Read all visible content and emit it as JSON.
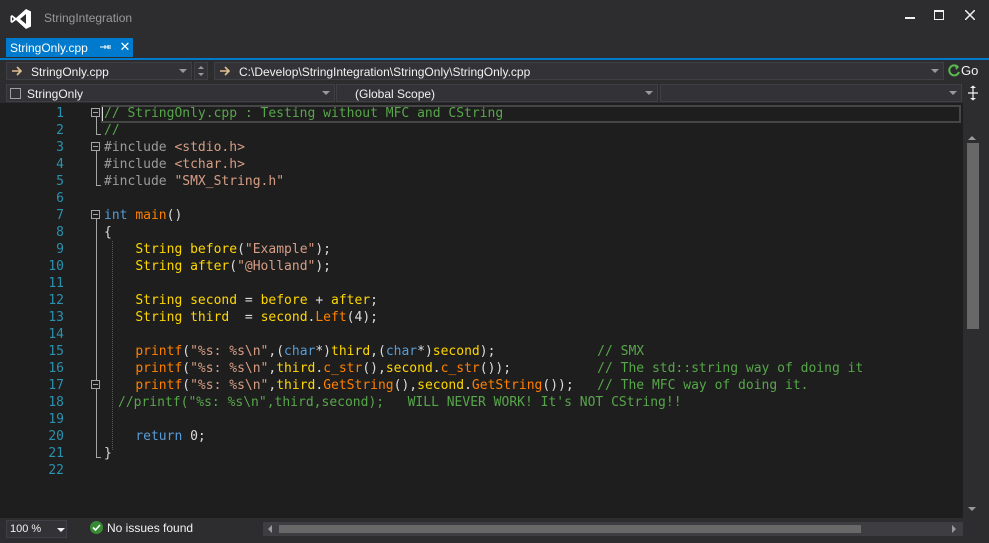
{
  "window": {
    "title": "StringIntegration"
  },
  "tabs": [
    {
      "label": "StringOnly.cpp",
      "active": true
    }
  ],
  "nav": {
    "file_combo": "StringOnly.cpp",
    "path_combo": "C:\\Develop\\StringIntegration\\StringOnly\\StringOnly.cpp",
    "go_label": "Go",
    "project_combo": "StringOnly",
    "scope_combo": "(Global Scope)",
    "member_combo": ""
  },
  "editor": {
    "line_numbers": [
      "1",
      "2",
      "3",
      "4",
      "5",
      "6",
      "7",
      "8",
      "9",
      "10",
      "11",
      "12",
      "13",
      "14",
      "15",
      "16",
      "17",
      "18",
      "19",
      "20",
      "21",
      "22"
    ]
  },
  "status": {
    "zoom": "100 %",
    "issues": "No issues found"
  },
  "colors": {
    "accent": "#007acc",
    "comment": "#57a64a",
    "keyword": "#569cd6",
    "string": "#d69d85",
    "function": "#ff8000",
    "class": "#ffd700",
    "line_number": "#2b91af"
  }
}
